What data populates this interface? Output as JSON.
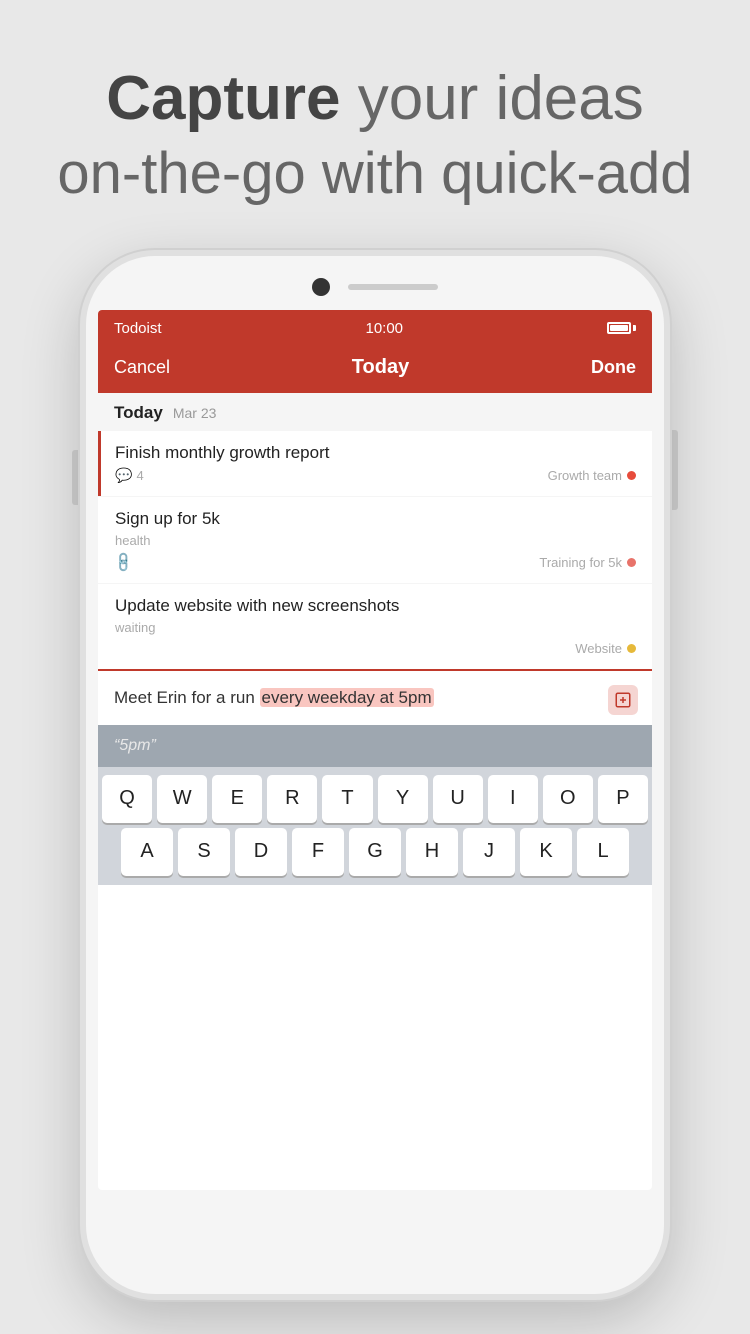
{
  "headline": {
    "bold": "Capture",
    "rest_line1": " your ideas",
    "line2": "on-the-go with quick-add"
  },
  "status_bar": {
    "app_name": "Todoist",
    "time": "10:00"
  },
  "nav": {
    "cancel": "Cancel",
    "title": "Today",
    "done": "Done"
  },
  "section": {
    "title": "Today",
    "date": "Mar 23"
  },
  "tasks": [
    {
      "title": "Finish monthly growth report",
      "label": "",
      "comments": "4",
      "has_link": false,
      "project": "Growth team",
      "dot_class": "dot-red"
    },
    {
      "title": "Sign up for 5k",
      "label": "health",
      "comments": "",
      "has_link": true,
      "project": "Training for 5k",
      "dot_class": "dot-coral"
    },
    {
      "title": "Update website with new screenshots",
      "label": "waiting",
      "comments": "",
      "has_link": false,
      "project": "Website",
      "dot_class": "dot-yellow"
    }
  ],
  "quick_add": {
    "text_before": "Meet Erin for a run ",
    "highlight": "every weekday at 5pm",
    "text_after": ""
  },
  "smart_suggestion": {
    "text": "“5pm”"
  },
  "keyboard": {
    "row1": [
      "Q",
      "W",
      "E",
      "R",
      "T",
      "Y",
      "U",
      "I",
      "O",
      "P"
    ],
    "row2": [
      "A",
      "S",
      "D",
      "F",
      "G",
      "H",
      "J",
      "K",
      "L"
    ]
  }
}
